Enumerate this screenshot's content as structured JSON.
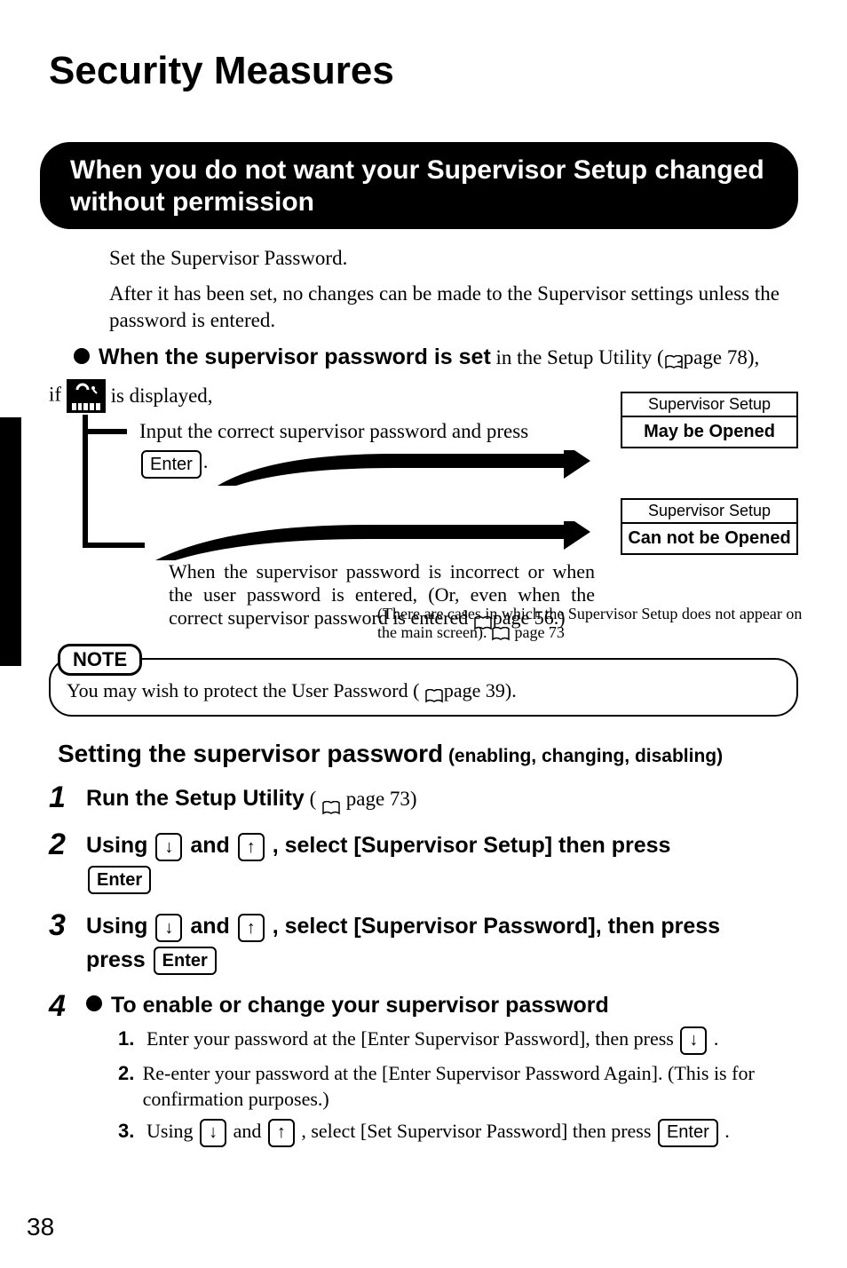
{
  "title": "Security Measures",
  "banner": "When you do not want your Supervisor Setup changed without permission",
  "intro": {
    "line1": "Set the Supervisor Password.",
    "line2": "After it has been set, no changes can be made to the Supervisor settings unless the password is entered."
  },
  "when_set": {
    "prefix_bold": "When the supervisor password is set",
    "suffix": " in the Setup Utility  (",
    "pageref": "page 78),"
  },
  "diagram": {
    "if": "if",
    "is_displayed": " is displayed,",
    "input_text": "Input the correct supervisor password and press",
    "enter": "Enter",
    "dot": ".",
    "box1_header": "Supervisor Setup",
    "box1_body": "May be Opened",
    "box2_header": "Supervisor Setup",
    "box2_body": "Can not be Opened",
    "wrong_text": "When the supervisor password is incorrect or when the user password is entered, (Or, even when the correct supervisor password is entered ",
    "wrong_page": "page 56.)",
    "footnote_a": "(There are cases in which the Supervisor Setup does not appear on the main screen).  ",
    "footnote_page": " page 73"
  },
  "note": {
    "label": "NOTE",
    "text_a": "You may wish to protect the User Password ( ",
    "text_page": "page 39)."
  },
  "subhead": {
    "bold": "Setting the supervisor password",
    "paren": " (enabling, changing, disabling)"
  },
  "steps": {
    "s1": {
      "n": "1",
      "bold": "Run the Setup Utility",
      "paren_a": " ( ",
      "paren_b": " page 73)"
    },
    "s2": {
      "n": "2",
      "a": "Using ",
      "b": " and ",
      "c": " , select [Supervisor Setup] then press"
    },
    "s3": {
      "n": "3",
      "a": "Using ",
      "b": " and ",
      "c": " , select [Supervisor Password], then press "
    },
    "s4": {
      "n": "4",
      "head": "To enable or change your supervisor password",
      "sub1_a": "Enter your password at the [Enter Supervisor Password], then press ",
      "sub1_b": " .",
      "sub2": "Re-enter your password at the [Enter Supervisor Password Again]. (This is for confirmation purposes.)",
      "sub3_a": "Using ",
      "sub3_b": " and ",
      "sub3_c": " , select [Set Supervisor Password] then press ",
      "sub3_d": " ."
    }
  },
  "keys": {
    "enter": "Enter",
    "down": "↓",
    "up": "↑"
  },
  "pagenum": "38"
}
